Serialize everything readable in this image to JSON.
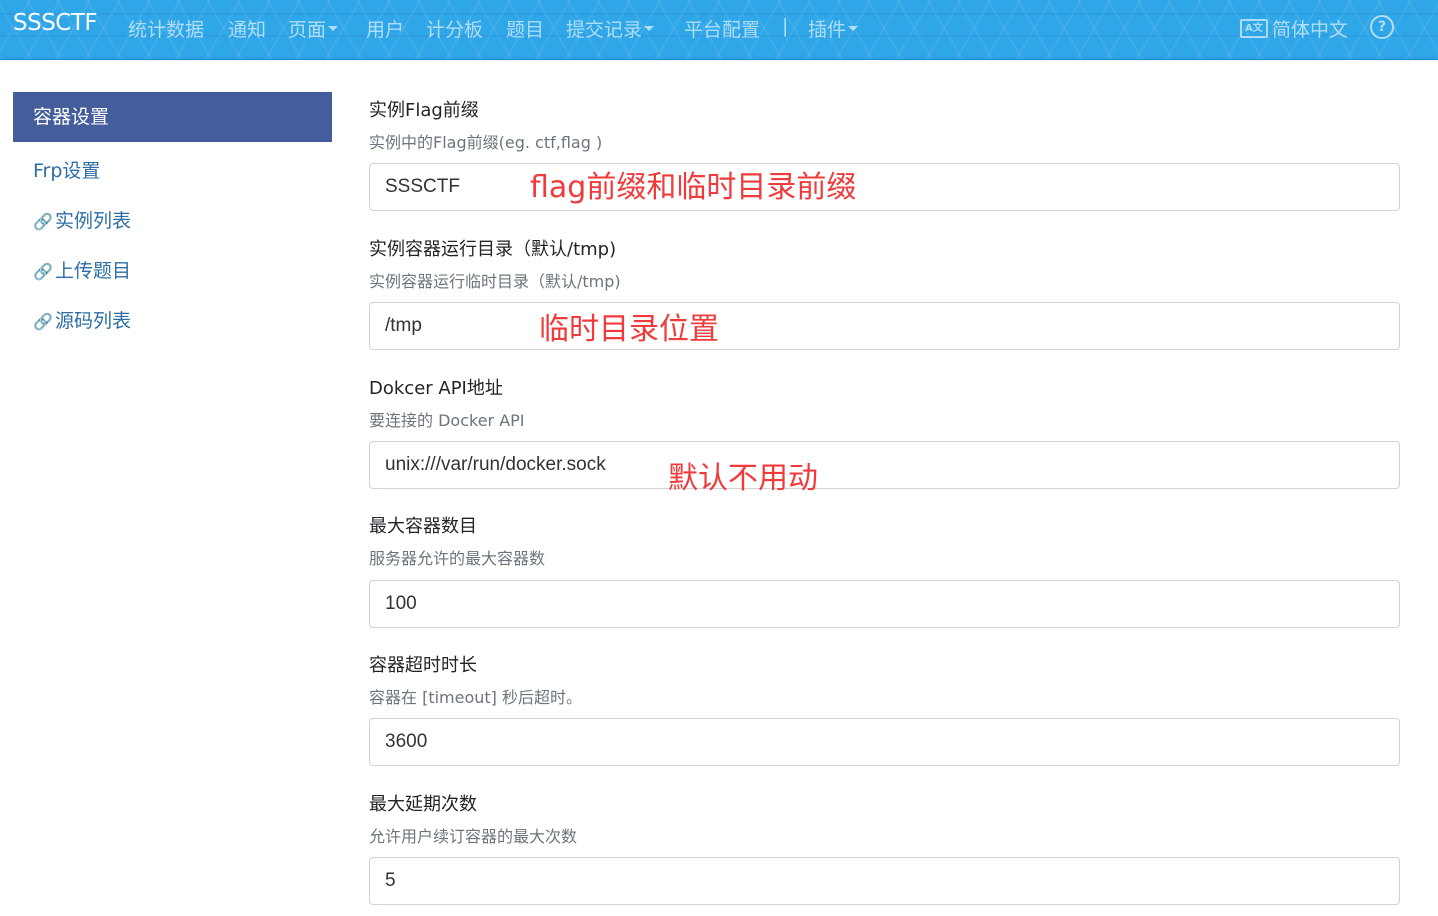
{
  "navbar": {
    "brand": "SSSCTF",
    "items": [
      {
        "label": "统计数据"
      },
      {
        "label": "通知"
      },
      {
        "label": "页面"
      },
      {
        "label": "用户"
      },
      {
        "label": "计分板"
      },
      {
        "label": "题目"
      },
      {
        "label": "提交记录"
      },
      {
        "label": "平台配置"
      },
      {
        "label": "|"
      },
      {
        "label": "插件"
      }
    ],
    "language": "简体中文",
    "language_icon": "translate-icon",
    "help_icon": "help-circle-icon",
    "help_glyph": "?"
  },
  "sidebar": {
    "active": "容器设置",
    "items": [
      {
        "label": "Frp设置",
        "icon": ""
      },
      {
        "label": "实例列表",
        "icon": "link-icon"
      },
      {
        "label": "上传题目",
        "icon": "link-icon"
      },
      {
        "label": "源码列表",
        "icon": "link-icon"
      }
    ]
  },
  "form": {
    "fields": [
      {
        "label": "实例Flag前缀",
        "help": "实例中的Flag前缀(eg. ctf,flag )",
        "value": "SSSCTF"
      },
      {
        "label": "实例容器运行目录（默认/tmp)",
        "help": "实例容器运行临时目录（默认/tmp)",
        "value": "/tmp"
      },
      {
        "label": "Dokcer API地址",
        "help": "要连接的 Docker API",
        "value": "unix:///var/run/docker.sock"
      },
      {
        "label": "最大容器数目",
        "help": "服务器允许的最大容器数",
        "value": "100"
      },
      {
        "label": "容器超时时长",
        "help": "容器在 [timeout] 秒后超时。",
        "value": "3600"
      },
      {
        "label": "最大延期次数",
        "help": "允许用户续订容器的最大次数",
        "value": "5"
      }
    ]
  },
  "annotations": [
    {
      "text": "flag前缀和临时目录前缀",
      "color": "#ef3b3b"
    },
    {
      "text": "临时目录位置",
      "color": "#ef3b3b"
    },
    {
      "text": "默认不用动",
      "color": "#ef3b3b"
    }
  ]
}
